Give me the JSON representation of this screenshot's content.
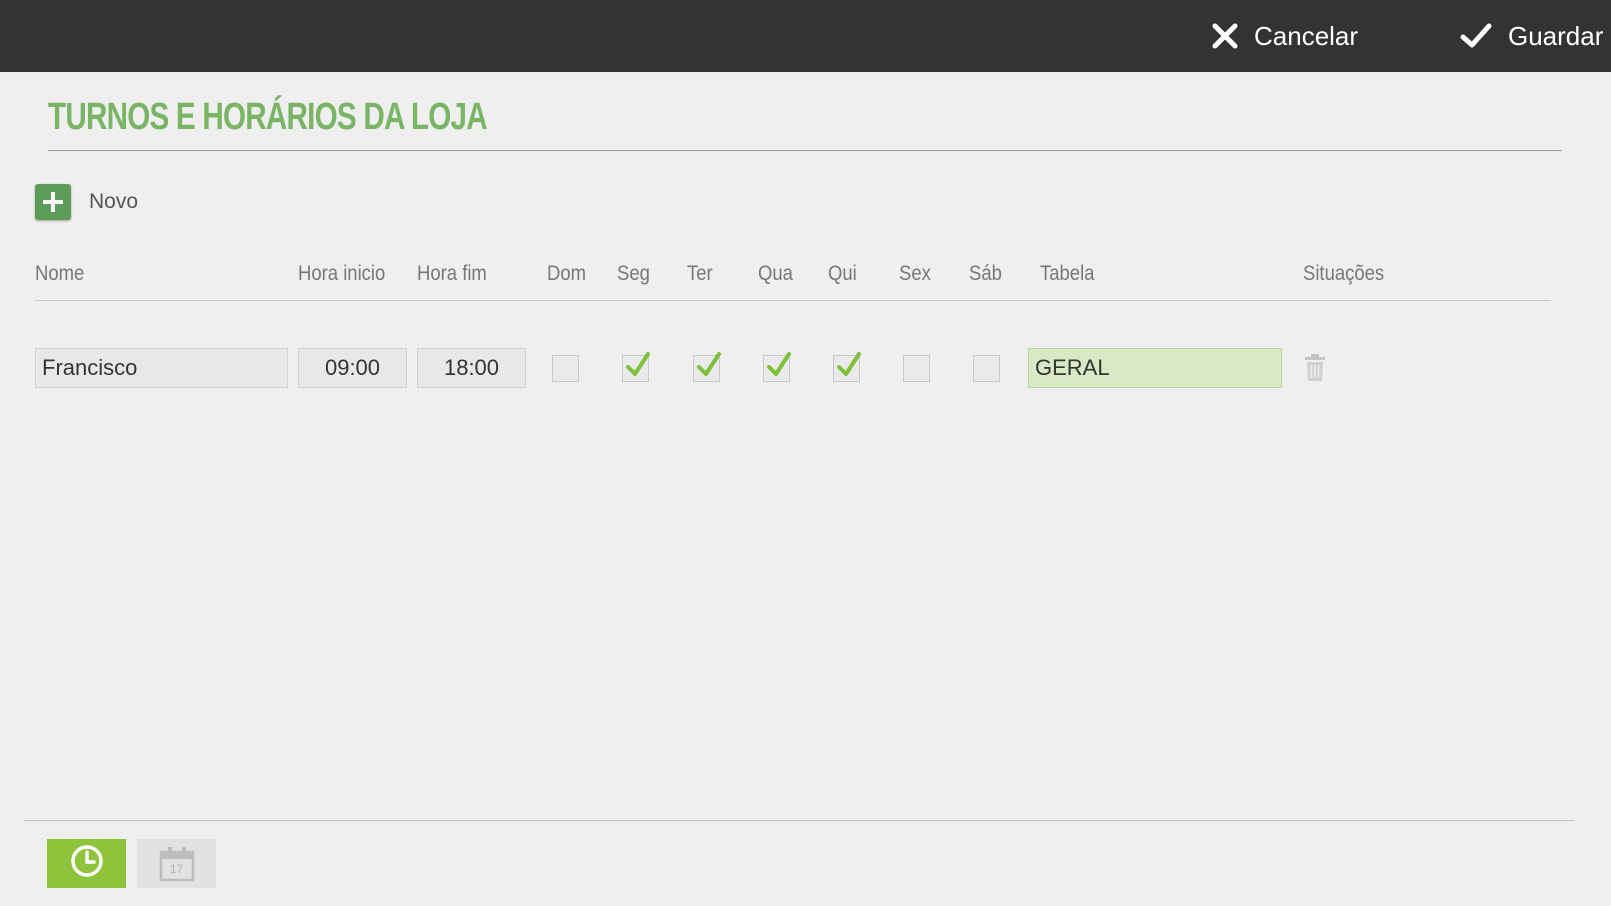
{
  "toolbar": {
    "cancel_label": "Cancelar",
    "save_label": "Guardar",
    "cancel_icon": "close-icon",
    "save_icon": "checkmark-icon"
  },
  "page": {
    "title": "TURNOS E HORÁRIOS DA LOJA"
  },
  "actions": {
    "new_label": "Novo",
    "new_icon": "plus-icon"
  },
  "table": {
    "columns": [
      "Nome",
      "Hora inicio",
      "Hora fim",
      "Dom",
      "Seg",
      "Ter",
      "Qua",
      "Qui",
      "Sex",
      "Sáb",
      "Tabela",
      "Situações"
    ],
    "rows": [
      {
        "nome": "Francisco",
        "hora_inicio": "09:00",
        "hora_fim": "18:00",
        "days": {
          "dom": false,
          "seg": true,
          "ter": true,
          "qua": true,
          "qui": true,
          "sex": false,
          "sab": false
        },
        "tabela": "GERAL",
        "delete_icon": "trash-icon"
      }
    ]
  },
  "bottom_tabs": [
    {
      "icon": "clock-icon",
      "active": true
    },
    {
      "icon": "calendar-icon",
      "label": "17",
      "active": false
    }
  ],
  "colors": {
    "topbar": "#333333",
    "accent_green": "#7ab566",
    "check_green": "#7dc13a",
    "tab_active": "#8ec43b",
    "tabela_bg": "#d8eac5"
  }
}
